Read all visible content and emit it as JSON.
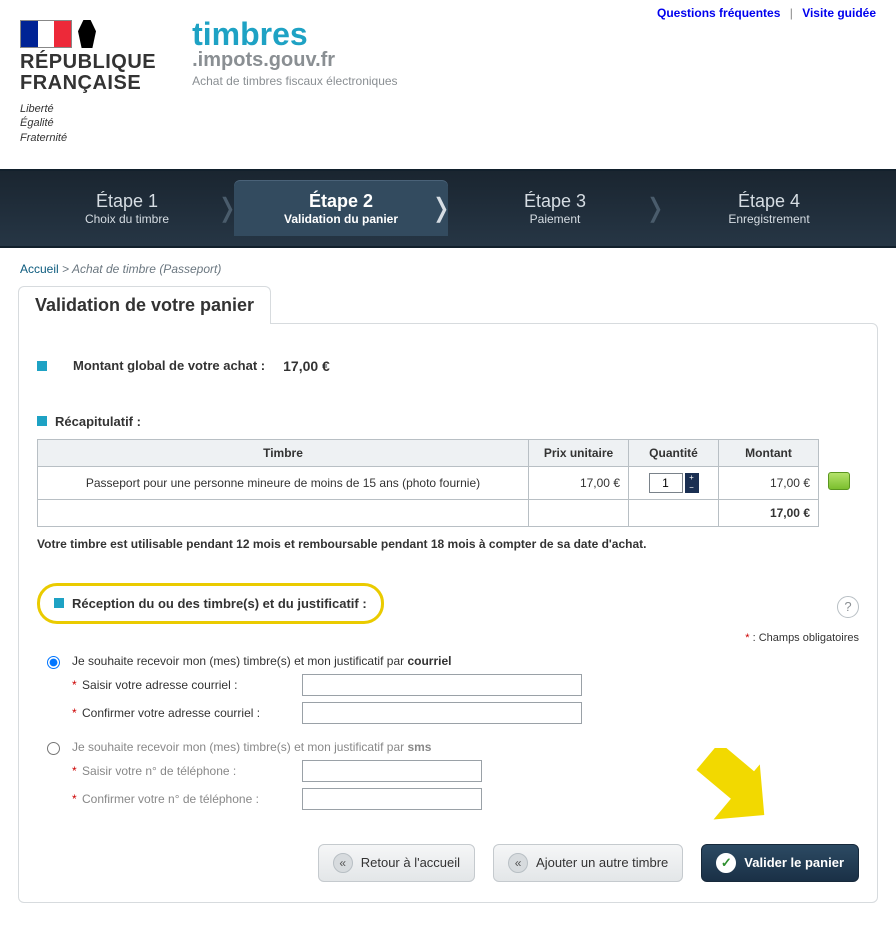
{
  "top_links": {
    "faq": "Questions fréquentes",
    "sep": "|",
    "tour": "Visite guidée"
  },
  "rf": {
    "line1": "RÉPUBLIQUE",
    "line2": "FRANÇAISE",
    "motto1": "Liberté",
    "motto2": "Égalité",
    "motto3": "Fraternité"
  },
  "site": {
    "title": "timbres",
    "domain": ".impots.gouv.fr",
    "subtitle": "Achat de timbres fiscaux électroniques"
  },
  "steps": [
    {
      "title": "Étape 1",
      "sub": "Choix du timbre"
    },
    {
      "title": "Étape 2",
      "sub": "Validation du panier"
    },
    {
      "title": "Étape 3",
      "sub": "Paiement"
    },
    {
      "title": "Étape 4",
      "sub": "Enregistrement"
    }
  ],
  "breadcrumb": {
    "home": "Accueil",
    "sep": ">",
    "current": "Achat de timbre (Passeport)"
  },
  "page_title": "Validation de votre panier",
  "total": {
    "label": "Montant global de votre achat :",
    "amount": "17,00 €"
  },
  "recap": {
    "title": "Récapitulatif :",
    "headers": {
      "product": "Timbre",
      "unit_price": "Prix unitaire",
      "qty": "Quantité",
      "amount": "Montant"
    },
    "rows": [
      {
        "label": "Passeport pour une personne mineure de moins de 15 ans (photo fournie)",
        "unit_price": "17,00 €",
        "qty": "1",
        "amount": "17,00 €"
      }
    ],
    "total_row": "17,00 €"
  },
  "validity_note": "Votre timbre est utilisable pendant 12 mois et remboursable pendant 18 mois à compter de sa date d'achat.",
  "reception_title": "Réception du ou des timbre(s) et du justificatif :",
  "required_note": {
    "ast": "*",
    "text": ": Champs obligatoires"
  },
  "delivery": {
    "email": {
      "title_pre": "Je souhaite recevoir mon (mes) timbre(s) et mon justificatif par ",
      "title_bold": "courriel",
      "f1": "Saisir votre adresse courriel :",
      "f2": "Confirmer votre adresse courriel :"
    },
    "sms": {
      "title_pre": "Je souhaite recevoir mon (mes) timbre(s) et mon justificatif par ",
      "title_bold": "sms",
      "f1": "Saisir votre n° de téléphone :",
      "f2": "Confirmer votre n° de téléphone :"
    }
  },
  "buttons": {
    "home": "Retour à l'accueil",
    "add": "Ajouter un autre timbre",
    "validate": "Valider le panier"
  },
  "help_char": "?",
  "chevron_char": "❭",
  "back_char": "«",
  "plus_char": "+",
  "minus_char": "−"
}
